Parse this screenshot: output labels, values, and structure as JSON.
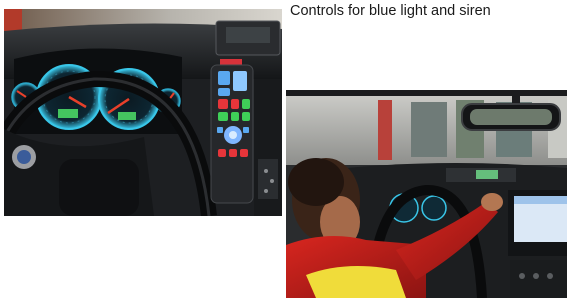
{
  "caption": "Controls for blue light and siren",
  "colors": {
    "background": "#ffffff",
    "caption_text": "#1a1a1a",
    "dashboard_dark": "#1d1f22",
    "gauge_glow": "#39c6e8",
    "needle_red": "#e8402a",
    "control_blue": "#5aa8f0",
    "control_red": "#e6353a",
    "control_green": "#3fcf58",
    "jacket_red": "#c8201c",
    "reflective_yellow": "#f0dc3a"
  },
  "images": [
    {
      "name": "car-dashboard-with-siren-controller",
      "icons": [
        "steering-wheel",
        "speedometer",
        "tachometer",
        "siren-control-panel"
      ]
    },
    {
      "name": "paramedic-pressing-controls",
      "icons": [
        "rear-view-mirror",
        "paramedic",
        "navigation-screen",
        "steering-wheel"
      ]
    }
  ]
}
